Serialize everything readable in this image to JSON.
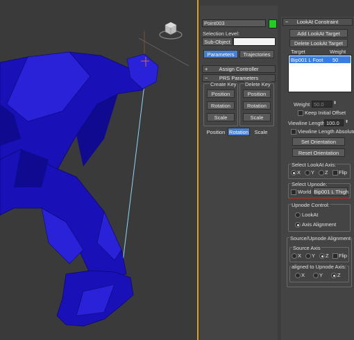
{
  "command_panel": {
    "object_name": "Point003",
    "object_color": "#22cc22",
    "selection_level_label": "Selection Level:",
    "sub_object": "Sub-Object",
    "tabs": [
      {
        "label": "Parameters",
        "active": true
      },
      {
        "label": "Trajectories",
        "active": false
      }
    ],
    "assign_controller": "Assign Controller",
    "prs": {
      "title": "PRS Parameters",
      "create_key": "Create Key",
      "delete_key": "Delete Key",
      "create_buttons": [
        "Position",
        "Rotation",
        "Scale"
      ],
      "delete_buttons": [
        "Position",
        "Rotation",
        "Scale"
      ],
      "bottom_tabs": [
        "Position",
        "Rotation",
        "Scale"
      ],
      "active_bottom_tab": "Rotation"
    }
  },
  "lookat": {
    "title": "LookAt Constraint",
    "add_button": "Add LookAt Target",
    "delete_button": "Delete LookAt Target",
    "col_target": "Target",
    "col_weight": "Weight",
    "rows": [
      {
        "target": "Bip001 L Foot",
        "weight": "50"
      }
    ],
    "weight_label": "Weight",
    "weight_value": "50.0",
    "keep_initial_offset": "Keep Initial Offset",
    "viewline_length_label": "Viewline Length",
    "viewline_length_value": "100.0",
    "viewline_absolute": "Viewline Length Absolute",
    "set_orientation": "Set Orientation",
    "reset_orientation": "Reset Orientation",
    "select_axis_label": "Select LookAt Axis:",
    "axis_options": [
      "X",
      "Y",
      "Z"
    ],
    "axis_selected": "X",
    "flip": "Flip",
    "select_upnode_label": "Select Upnode:",
    "world": "World",
    "upnode_value": "Bip001 L Thigh",
    "upnode_control_label": "Upnode Control:",
    "upnode_control_options": [
      "LookAt",
      "Axis Alignment"
    ],
    "upnode_control_selected": "Axis Alignment",
    "alignment_label": "Source/Upnode Alignment",
    "source_axis_label": "Source Axis",
    "source_axis_options": [
      "X",
      "Y",
      "Z"
    ],
    "source_axis_selected": "Z",
    "aligned_label": "aligned to Upnode Axis:",
    "aligned_options": [
      "X",
      "Y",
      "Z"
    ],
    "aligned_selected": "Z"
  },
  "colors": {
    "accent": "#d9a020",
    "selection": "#4a7fd0",
    "mesh": "#1a10b8",
    "underline": "#cc2222"
  }
}
